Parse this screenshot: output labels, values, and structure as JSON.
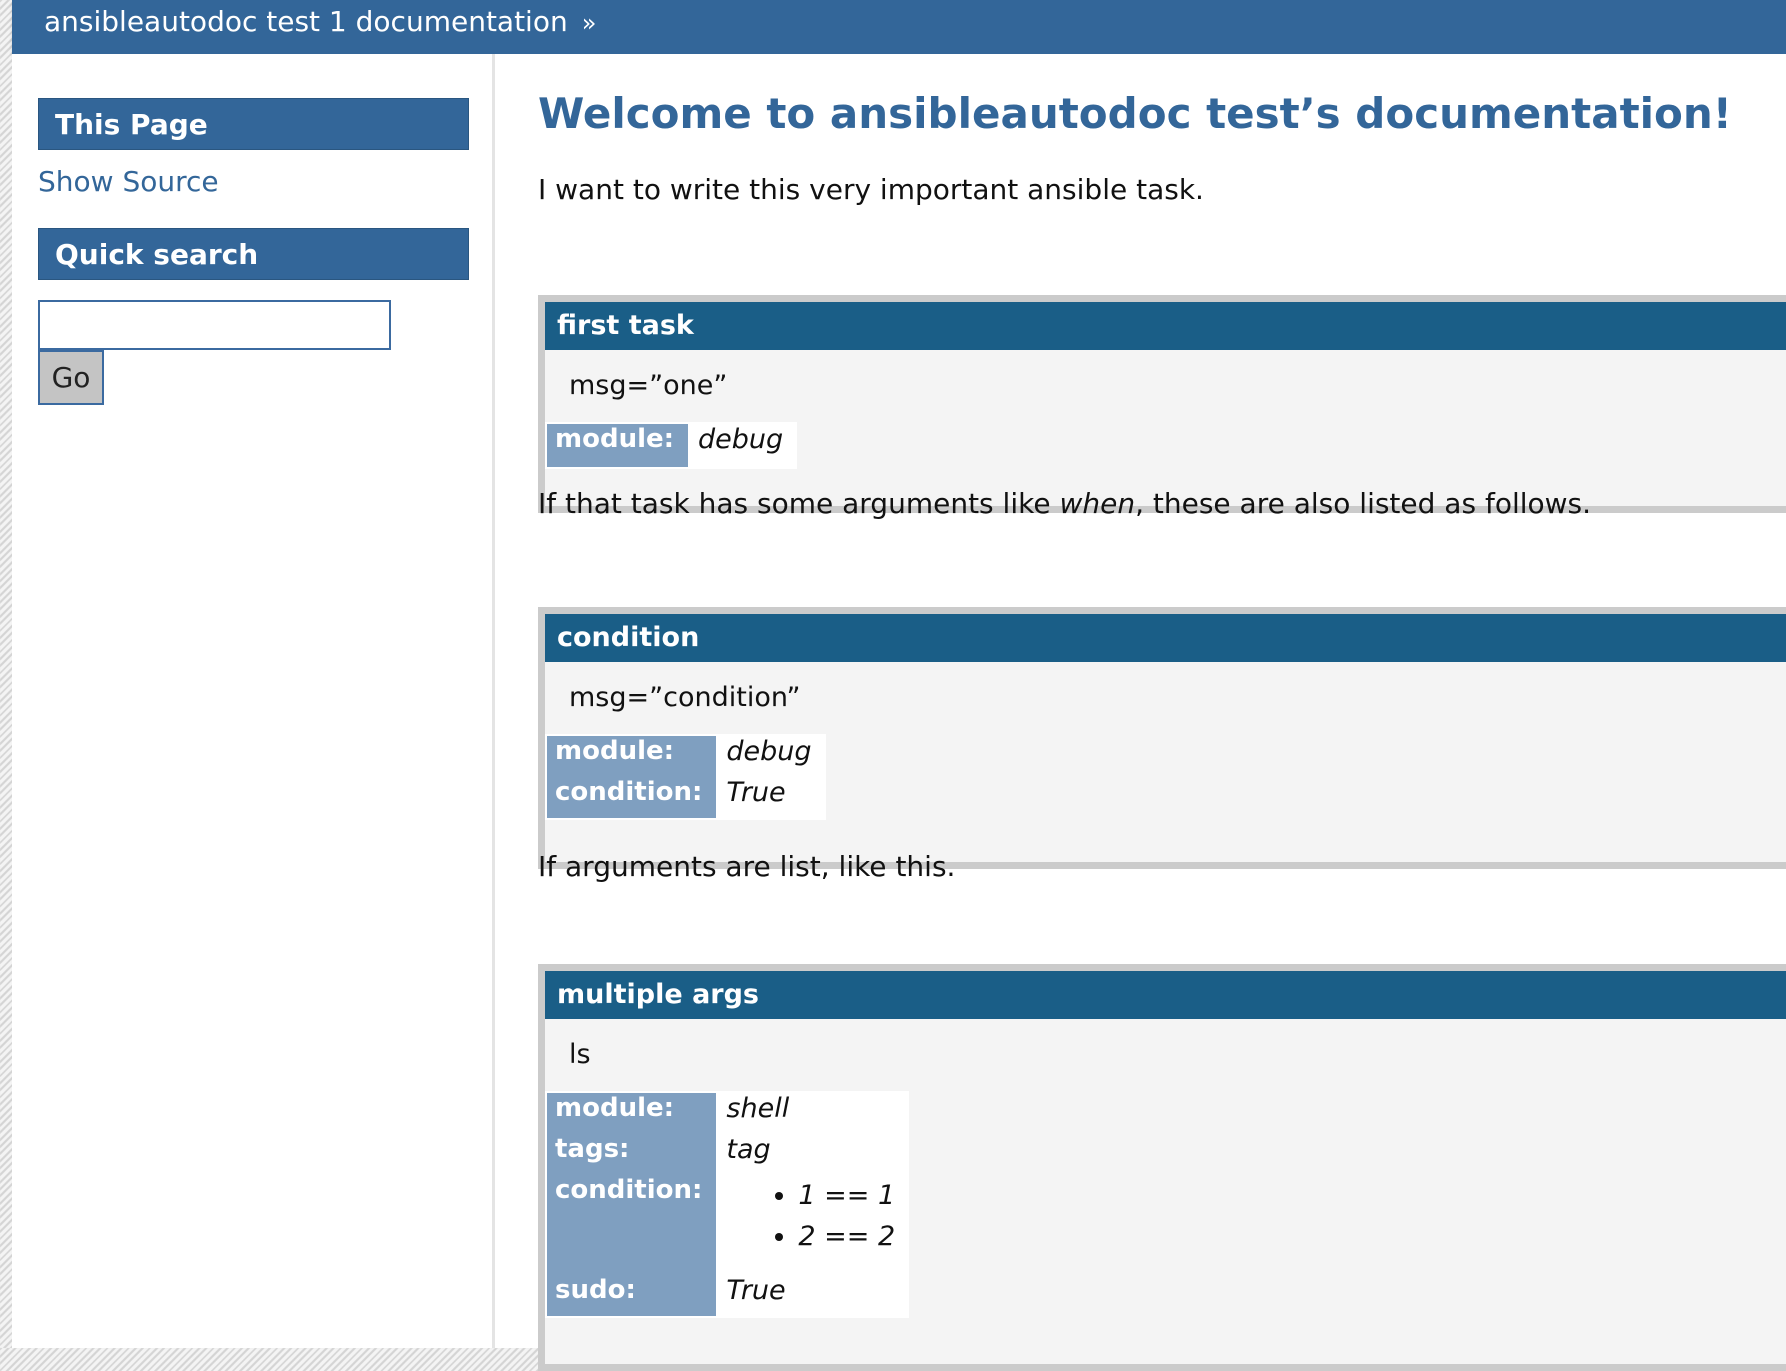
{
  "header": {
    "breadcrumb_title": "ansibleautodoc test 1 documentation",
    "breadcrumb_separator": "»"
  },
  "sidebar": {
    "this_page_heading": "This Page",
    "show_source_link": "Show Source",
    "quick_search_heading": "Quick search",
    "search_value": "",
    "go_button": "Go"
  },
  "main": {
    "title": "Welcome to ansibleautodoc test’s documentation!",
    "intro": "I want to write this very important ansible task.",
    "para_conditions": {
      "before": "If that task has some arguments like ",
      "emphasis": "when",
      "after": ", these are also listed as follows."
    },
    "para_list": "If arguments are list, like this.",
    "tasks": [
      {
        "name": "first task",
        "args": "msg=”one”",
        "fields": [
          {
            "label": "module:",
            "value": "debug"
          }
        ]
      },
      {
        "name": "condition",
        "args": "msg=”condition”",
        "fields": [
          {
            "label": "module:",
            "value": "debug"
          },
          {
            "label": "condition:",
            "value": "True"
          }
        ]
      },
      {
        "name": "multiple args",
        "args": "ls",
        "fields": [
          {
            "label": "module:",
            "value": "shell"
          },
          {
            "label": "tags:",
            "value": "tag"
          },
          {
            "label": "condition:",
            "list": [
              "1 == 1",
              "2 == 2"
            ]
          },
          {
            "label": "sudo:",
            "value": "True"
          }
        ]
      }
    ]
  },
  "colors": {
    "header_bg": "#336699",
    "task_title_bg": "#1a5e87",
    "field_label_bg": "#7f9fc0",
    "link": "#336699"
  }
}
